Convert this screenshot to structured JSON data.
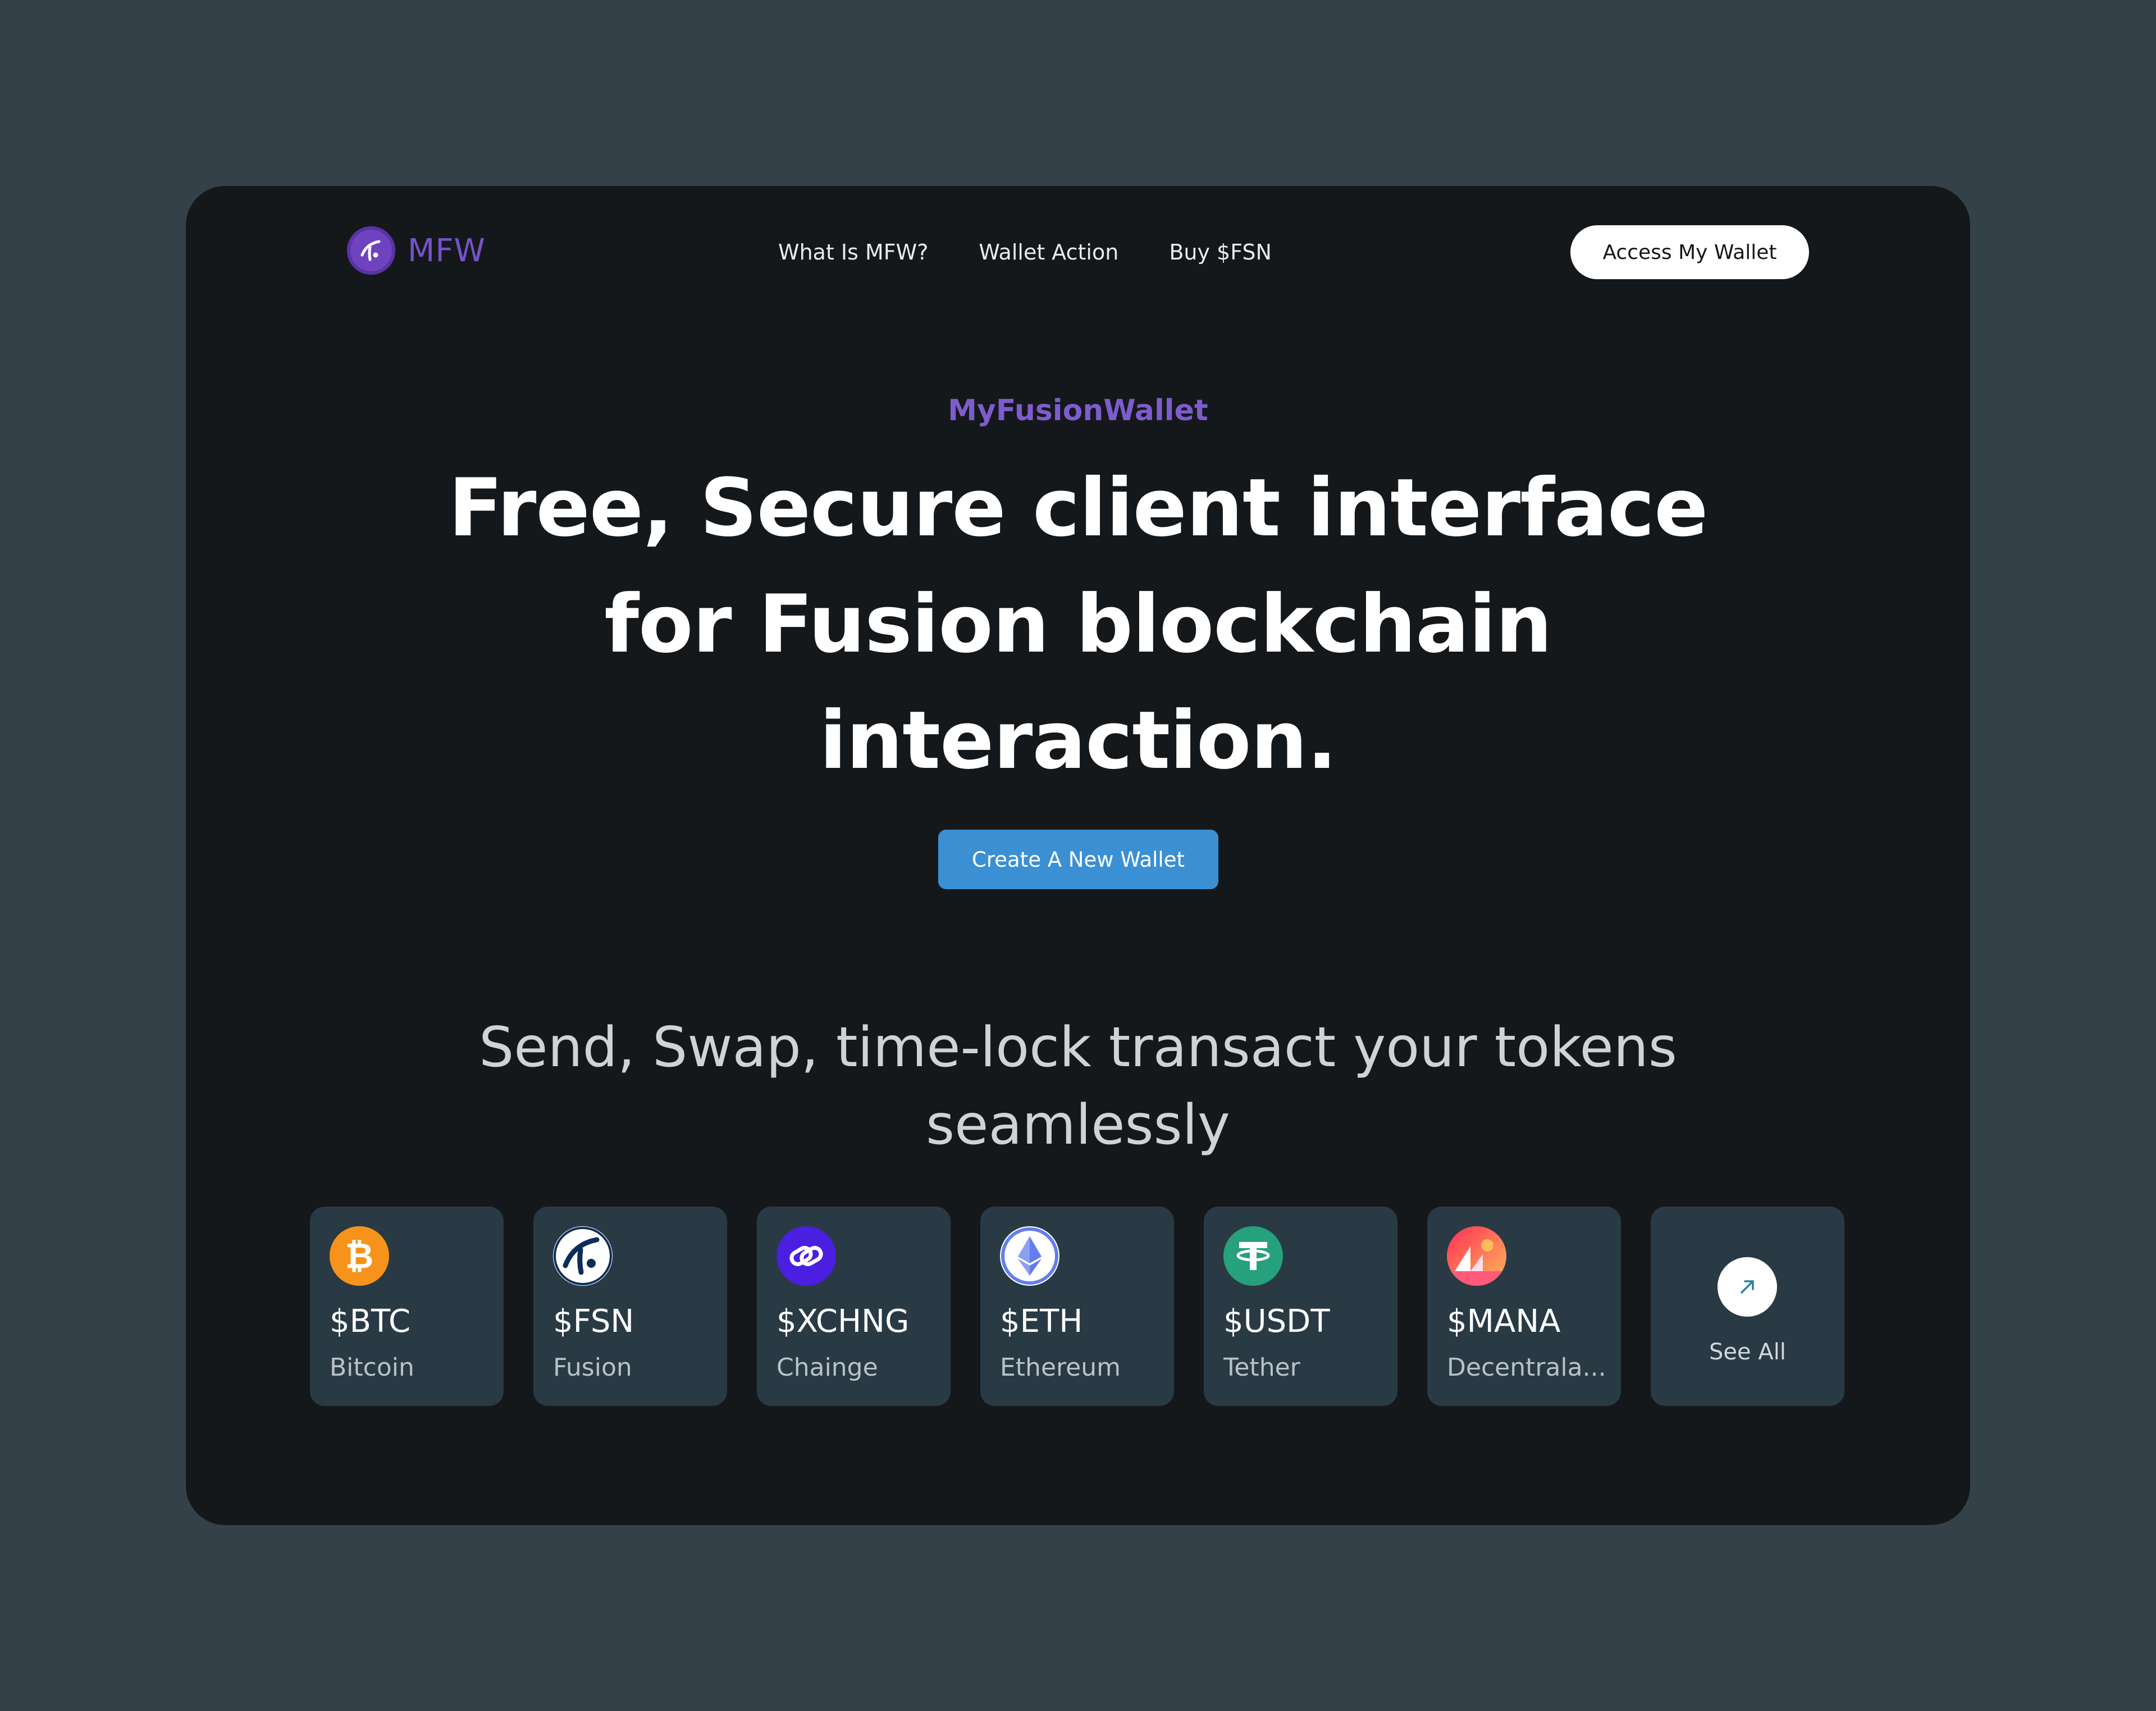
{
  "nav": {
    "logo_text": "MFW",
    "links": [
      "What Is MFW?",
      "Wallet Action",
      "Buy $FSN"
    ],
    "access_button": "Access My Wallet"
  },
  "hero": {
    "eyebrow": "MyFusionWallet",
    "headline_lines": [
      "Free, Secure client interface",
      "for Fusion blockchain",
      "interaction."
    ],
    "cta": "Create A New Wallet",
    "subhead_lines": [
      "Send, Swap, time-lock transact your tokens",
      "seamlessly"
    ]
  },
  "tokens": [
    {
      "symbol": "$BTC",
      "name": "Bitcoin",
      "icon": "bitcoin-icon",
      "color": "#f7931a"
    },
    {
      "symbol": "$FSN",
      "name": "Fusion",
      "icon": "fusion-icon",
      "color": "#0c2d5b"
    },
    {
      "symbol": "$XCHNG",
      "name": "Chainge",
      "icon": "chainge-icon",
      "color": "#4a1fe0"
    },
    {
      "symbol": "$ETH",
      "name": "Ethereum",
      "icon": "ethereum-icon",
      "color": "#627eea"
    },
    {
      "symbol": "$USDT",
      "name": "Tether",
      "icon": "tether-icon",
      "color": "#26a17b"
    },
    {
      "symbol": "$MANA",
      "name": "Decentrala...",
      "icon": "decentraland-icon",
      "color": "#ff5a5f"
    }
  ],
  "see_all": {
    "label": "See All",
    "icon": "arrow-up-right-icon"
  },
  "colors": {
    "background": "#344149",
    "frame": "#15181b",
    "card": "#293a44",
    "accent_purple": "#7d5ccd",
    "cta_blue": "#3a90d3"
  }
}
